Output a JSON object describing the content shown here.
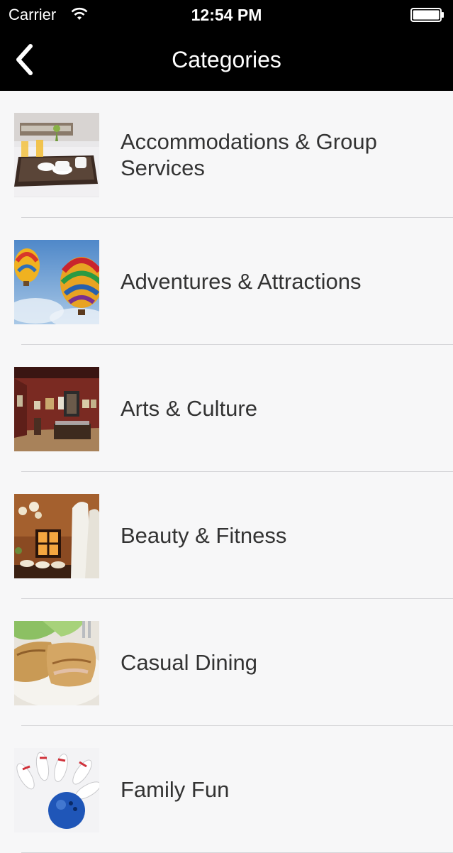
{
  "status": {
    "carrier": "Carrier",
    "time": "12:54 PM"
  },
  "nav": {
    "title": "Categories",
    "back_icon": "chevron-left-icon"
  },
  "categories": [
    {
      "label": "Accommodations & Group Services",
      "thumb": "hotel-tray-photo"
    },
    {
      "label": "Adventures & Attractions",
      "thumb": "hot-air-balloons-photo"
    },
    {
      "label": "Arts & Culture",
      "thumb": "museum-gallery-photo"
    },
    {
      "label": "Beauty & Fitness",
      "thumb": "spa-photo"
    },
    {
      "label": "Casual Dining",
      "thumb": "food-plate-photo"
    },
    {
      "label": "Family Fun",
      "thumb": "bowling-photo"
    }
  ],
  "colors": {
    "bar": "#000000",
    "list_bg": "#f7f7f8",
    "separator": "#d5d5d8",
    "label_text": "#333333"
  }
}
